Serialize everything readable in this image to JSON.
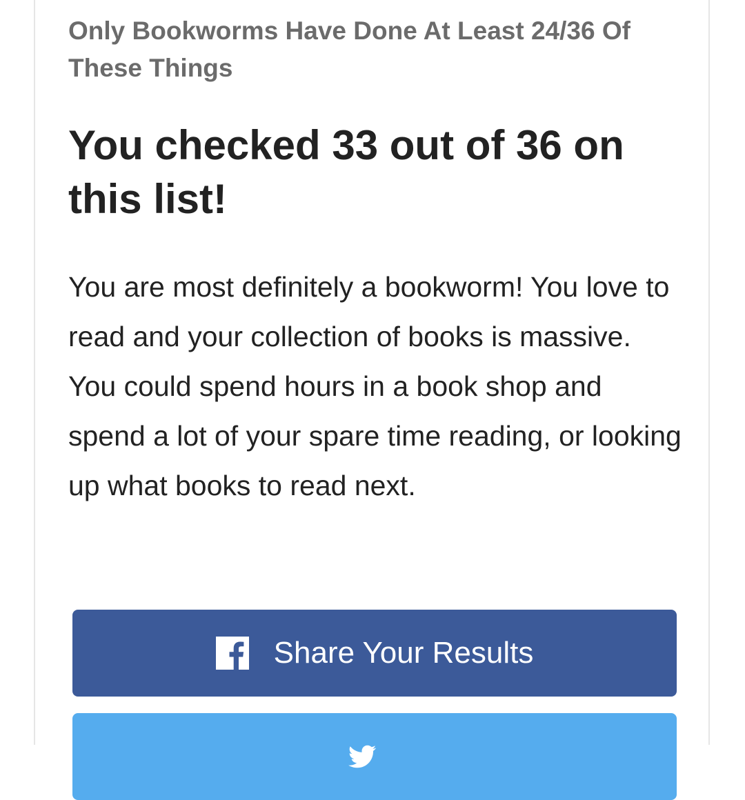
{
  "quiz": {
    "title": "Only Bookworms Have Done At Least 24/36 Of These Things"
  },
  "result": {
    "heading": "You checked 33 out of 36 on this list!",
    "description": "You are most definitely a bookworm! You love to read and your collection of books is massive. You could spend hours in a book shop and spend a lot of your spare time reading, or looking up what books to read next."
  },
  "share": {
    "facebook": {
      "label": "Share Your Results",
      "icon": "facebook-icon",
      "color": "#3c5a99"
    },
    "twitter": {
      "label": "",
      "icon": "twitter-icon",
      "color": "#55acee"
    }
  }
}
